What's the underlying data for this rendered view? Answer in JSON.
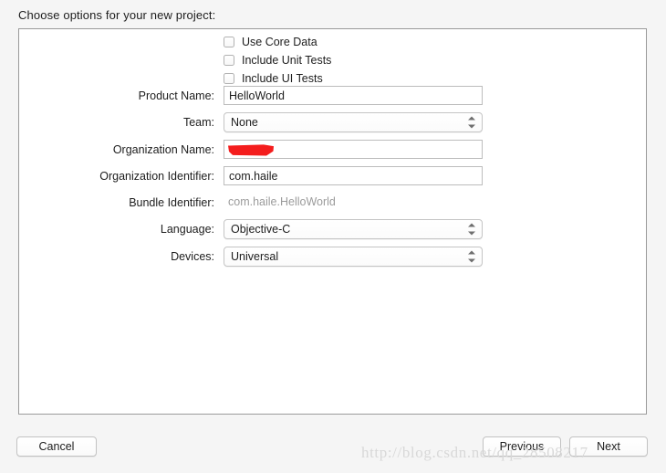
{
  "prompt": "Choose options for your new project:",
  "form": {
    "rows": [
      {
        "label": "Product Name:",
        "type": "text",
        "value": "HelloWorld"
      },
      {
        "label": "Team:",
        "type": "popup",
        "value": "None"
      },
      {
        "label": "Organization Name:",
        "type": "redacted",
        "value": ""
      },
      {
        "label": "Organization Identifier:",
        "type": "text",
        "value": "com.haile"
      },
      {
        "label": "Bundle Identifier:",
        "type": "readonly",
        "value": "com.haile.HelloWorld"
      },
      {
        "label": "Language:",
        "type": "popup",
        "value": "Objective-C"
      },
      {
        "label": "Devices:",
        "type": "popup",
        "value": "Universal"
      }
    ]
  },
  "checkboxes": [
    {
      "label": "Use Core Data",
      "checked": false
    },
    {
      "label": "Include Unit Tests",
      "checked": false
    },
    {
      "label": "Include UI Tests",
      "checked": false
    }
  ],
  "footer": {
    "cancel_label": "Cancel",
    "previous_label": "Previous",
    "next_label": "Next"
  },
  "watermark": "http://blog.csdn.net/qq_28508217",
  "colors": {
    "page_background": "#f5f5f5",
    "panel_background": "#ffffff",
    "panel_border": "#9a9a9a",
    "text": "#1d1d1d",
    "readonly_text": "#9b9b9b",
    "redaction": "#f41d1d",
    "watermark": "#d8d8d8"
  }
}
